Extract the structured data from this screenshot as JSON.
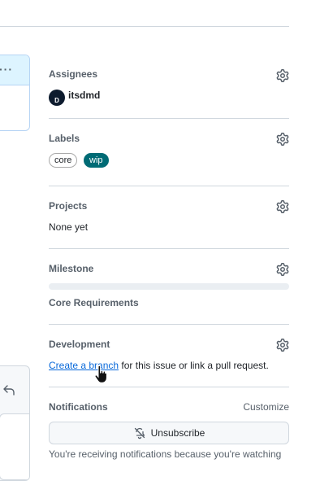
{
  "assignees": {
    "title": "Assignees",
    "users": [
      {
        "name": "itsdmd",
        "avatar_initial": "D"
      }
    ]
  },
  "labels": {
    "title": "Labels",
    "items": [
      {
        "name": "core",
        "color": "#ffffff"
      },
      {
        "name": "wip",
        "color": "#006b75"
      }
    ]
  },
  "projects": {
    "title": "Projects",
    "value": "None yet"
  },
  "milestone": {
    "title": "Milestone",
    "name": "Core Requirements",
    "progress": 0
  },
  "development": {
    "title": "Development",
    "link_text": "Create a branch",
    "rest_text": " for this issue or link a pull request."
  },
  "notifications": {
    "title": "Notifications",
    "customize_label": "Customize",
    "unsubscribe_label": "Unsubscribe",
    "note": "You're receiving notifications because you're watching"
  },
  "icons": {
    "gear": "gear-icon",
    "bell_slash": "bell-slash-icon",
    "reply": "reply-icon",
    "kebab": "kebab-horizontal-icon",
    "cursor": "hand-pointer-cursor"
  },
  "colors": {
    "accent_link": "#0969da",
    "wip_label": "#006b75"
  }
}
